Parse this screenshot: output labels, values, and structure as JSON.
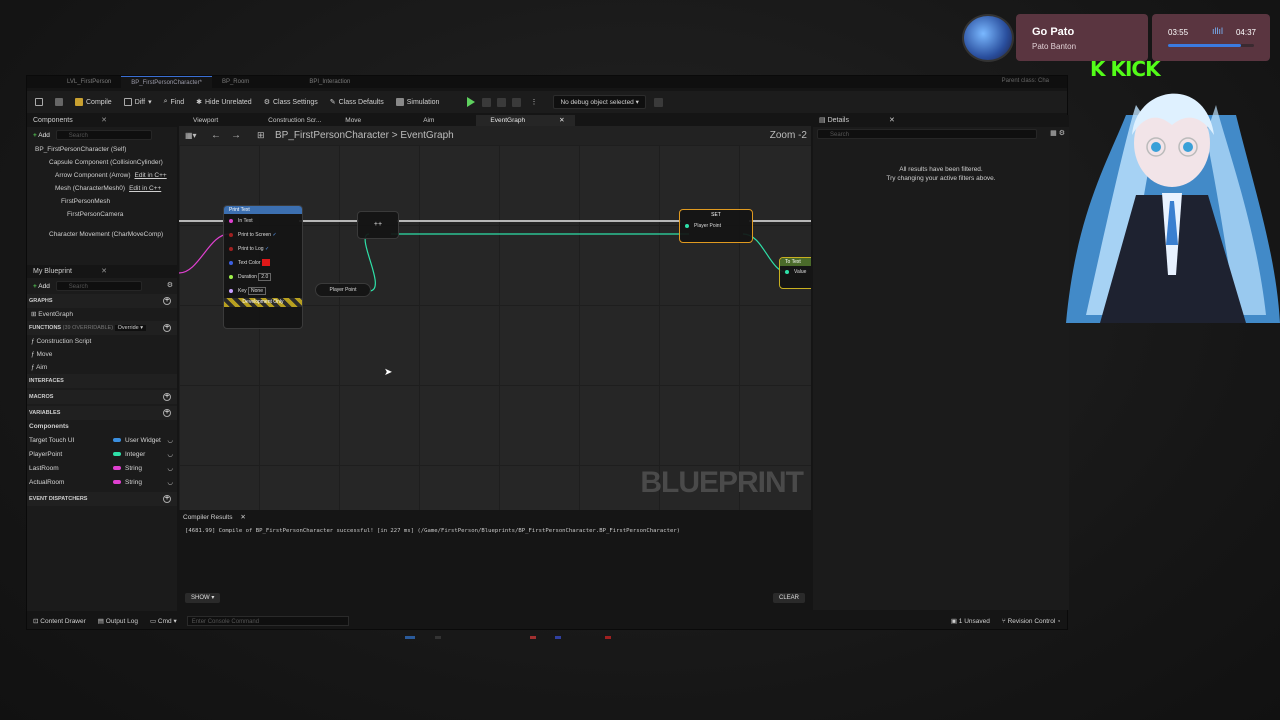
{
  "asset_tabs": [
    "LVL_FirstPerson",
    "BP_FirstPersonCharacter*",
    "BP_Room",
    "BPI_Interaction"
  ],
  "parent_class": "Parent class: Cha",
  "toolbar": {
    "compile": "Compile",
    "diff": "Diff",
    "find": "Find",
    "hide_unrelated": "Hide Unrelated",
    "class_settings": "Class Settings",
    "class_defaults": "Class Defaults",
    "simulation": "Simulation",
    "debug_select": "No debug object selected"
  },
  "components": {
    "tab": "Components",
    "add": "Add",
    "search_placeholder": "Search",
    "items": [
      {
        "label": "BP_FirstPersonCharacter (Self)"
      },
      {
        "label": "Capsule Component (CollisionCylinder)"
      },
      {
        "label": "Arrow Component (Arrow)",
        "link": "Edit in C++"
      },
      {
        "label": "Mesh (CharacterMesh0)",
        "link": "Edit in C++"
      },
      {
        "label": "FirstPersonMesh"
      },
      {
        "label": "FirstPersonCamera"
      },
      {
        "label": "Character Movement (CharMoveComp)"
      }
    ]
  },
  "my_blueprint": {
    "tab": "My Blueprint",
    "add": "Add",
    "search_placeholder": "Search",
    "graphs_head": "GRAPHS",
    "graph_item": "EventGraph",
    "functions_head": "FUNCTIONS",
    "functions_count": "(39 OVERRIDABLE)",
    "override": "Override",
    "functions": [
      "Construction Script",
      "Move",
      "Aim"
    ],
    "interfaces_head": "INTERFACES",
    "macros_head": "MACROS",
    "variables_head": "VARIABLES",
    "components_sub": "Components",
    "variables": [
      {
        "name": "Target Touch UI",
        "type": "User Widget",
        "color": "#3b8fe0"
      },
      {
        "name": "PlayerPoint",
        "type": "Integer",
        "color": "#2ee0a8"
      },
      {
        "name": "LastRoom",
        "type": "String",
        "color": "#e040d0"
      },
      {
        "name": "ActualRoom",
        "type": "String",
        "color": "#e040d0"
      }
    ],
    "dispatchers_head": "EVENT DISPATCHERS"
  },
  "graph": {
    "tabs": [
      "Viewport",
      "Construction Scr...",
      "Move",
      "Aim",
      "EventGraph"
    ],
    "breadcrumb_root": "BP_FirstPersonCharacter",
    "breadcrumb_sep": ">",
    "breadcrumb_leaf": "EventGraph",
    "zoom": "Zoom -2",
    "watermark": "BLUEPRINT",
    "print_node": {
      "title": "Print Text",
      "in_text": "In Text",
      "print_screen": "Print to Screen",
      "print_log": "Print to Log",
      "text_color": "Text Color",
      "duration": "Duration",
      "duration_value": "2.0",
      "key": "Key",
      "key_value": "None",
      "dev_only": "Development Only"
    },
    "add_node": "++",
    "get_node": "Player Point",
    "set_node": {
      "title": "SET",
      "pin": "Player Point"
    },
    "to_text_node": {
      "title": "To Text",
      "pin": "Value"
    }
  },
  "compiler": {
    "tab": "Compiler Results",
    "message": "[4681.99] Compile of BP_FirstPersonCharacter successful! [in 227 ms] (/Game/FirstPerson/Blueprints/BP_FirstPersonCharacter.BP_FirstPersonCharacter)",
    "show": "SHOW",
    "clear": "CLEAR"
  },
  "details": {
    "tab": "Details",
    "search_placeholder": "Search",
    "filter_line1": "All results have been filtered.",
    "filter_line2": "Try changing your active filters above."
  },
  "status": {
    "content_drawer": "Content Drawer",
    "output_log": "Output Log",
    "cmd": "Cmd",
    "console_placeholder": "Enter Console Command",
    "unsaved": "1 Unsaved",
    "revision": "Revision Control"
  },
  "overlay": {
    "song": "Go Pato",
    "artist": "Pato Banton",
    "time_current": "03:55",
    "time_total": "04:37",
    "kick": "KICK",
    "progress": 0.85
  }
}
